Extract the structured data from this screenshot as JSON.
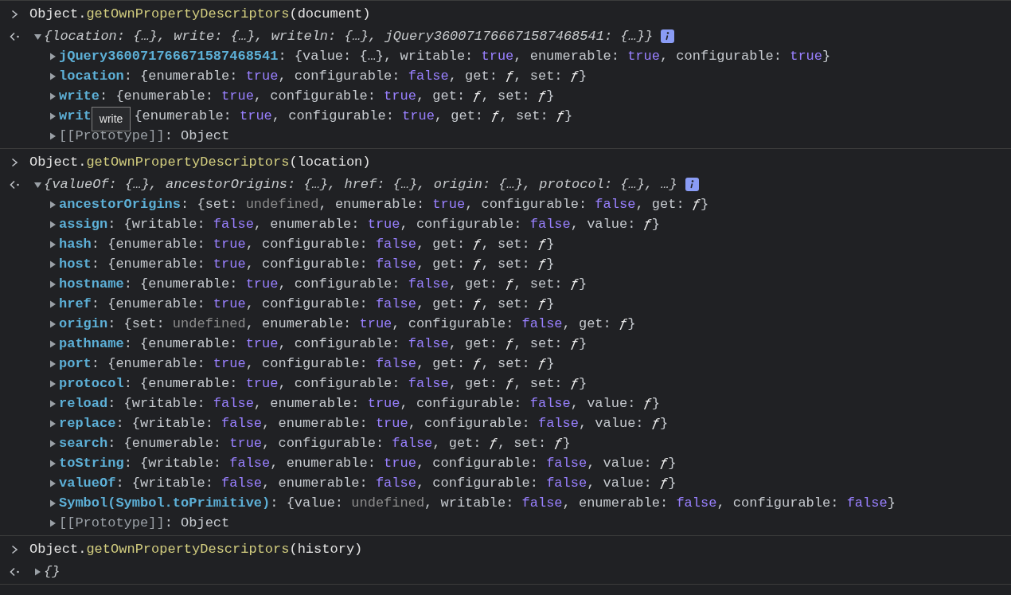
{
  "entries": [
    {
      "command": [
        {
          "text": "Object."
        },
        {
          "text": "getOwnPropertyDescriptors",
          "kind": "method"
        },
        {
          "text": "(document)"
        }
      ],
      "result": {
        "expanded": true,
        "summary": "{location: {…}, write: {…}, writeln: {…}, jQuery360071766671587468541: {…}}",
        "properties": [
          {
            "key": "jQuery360071766671587468541",
            "expanded": false,
            "value": [
              {
                "text": ": {value: {…}, writable: "
              },
              {
                "text": "true",
                "kind": "boolean"
              },
              {
                "text": ", enumerable: "
              },
              {
                "text": "true",
                "kind": "boolean"
              },
              {
                "text": ", configurable: "
              },
              {
                "text": "true",
                "kind": "boolean"
              },
              {
                "text": "}"
              }
            ]
          },
          {
            "key": "location",
            "expanded": false,
            "value": [
              {
                "text": ": {enumerable: "
              },
              {
                "text": "true",
                "kind": "boolean"
              },
              {
                "text": ", configurable: "
              },
              {
                "text": "false",
                "kind": "boolean"
              },
              {
                "text": ", get: "
              },
              {
                "text": "ƒ",
                "kind": "function"
              },
              {
                "text": ", set: "
              },
              {
                "text": "ƒ",
                "kind": "function"
              },
              {
                "text": "}"
              }
            ]
          },
          {
            "key": "write",
            "expanded": false,
            "value": [
              {
                "text": ": {enumerable: "
              },
              {
                "text": "true",
                "kind": "boolean"
              },
              {
                "text": ", configurable: "
              },
              {
                "text": "true",
                "kind": "boolean"
              },
              {
                "text": ", get: "
              },
              {
                "text": "ƒ",
                "kind": "function"
              },
              {
                "text": ", set: "
              },
              {
                "text": "ƒ",
                "kind": "function"
              },
              {
                "text": "}"
              }
            ]
          },
          {
            "key": "writ",
            "expanded": false,
            "tooltip": "write",
            "value": [
              {
                "text": "{enumerable: "
              },
              {
                "text": "true",
                "kind": "boolean"
              },
              {
                "text": ", configurable: "
              },
              {
                "text": "true",
                "kind": "boolean"
              },
              {
                "text": ", get: "
              },
              {
                "text": "ƒ",
                "kind": "function"
              },
              {
                "text": ", set: "
              },
              {
                "text": "ƒ",
                "kind": "function"
              },
              {
                "text": "}"
              }
            ]
          },
          {
            "key": "[[Prototype]]",
            "kind": "internal",
            "expanded": false,
            "value": [
              {
                "text": ": Object"
              }
            ]
          }
        ]
      }
    },
    {
      "command": [
        {
          "text": "Object."
        },
        {
          "text": "getOwnPropertyDescriptors",
          "kind": "method"
        },
        {
          "text": "(location)"
        }
      ],
      "result": {
        "expanded": true,
        "summary": "{valueOf: {…}, ancestorOrigins: {…}, href: {…}, origin: {…}, protocol: {…}, …}",
        "properties": [
          {
            "key": "ancestorOrigins",
            "expanded": false,
            "value": [
              {
                "text": ": {set: "
              },
              {
                "text": "undefined",
                "kind": "undefined"
              },
              {
                "text": ", enumerable: "
              },
              {
                "text": "true",
                "kind": "boolean"
              },
              {
                "text": ", configurable: "
              },
              {
                "text": "false",
                "kind": "boolean"
              },
              {
                "text": ", get: "
              },
              {
                "text": "ƒ",
                "kind": "function"
              },
              {
                "text": "}"
              }
            ]
          },
          {
            "key": "assign",
            "expanded": false,
            "value": [
              {
                "text": ": {writable: "
              },
              {
                "text": "false",
                "kind": "boolean"
              },
              {
                "text": ", enumerable: "
              },
              {
                "text": "true",
                "kind": "boolean"
              },
              {
                "text": ", configurable: "
              },
              {
                "text": "false",
                "kind": "boolean"
              },
              {
                "text": ", value: "
              },
              {
                "text": "ƒ",
                "kind": "function"
              },
              {
                "text": "}"
              }
            ]
          },
          {
            "key": "hash",
            "expanded": false,
            "value": [
              {
                "text": ": {enumerable: "
              },
              {
                "text": "true",
                "kind": "boolean"
              },
              {
                "text": ", configurable: "
              },
              {
                "text": "false",
                "kind": "boolean"
              },
              {
                "text": ", get: "
              },
              {
                "text": "ƒ",
                "kind": "function"
              },
              {
                "text": ", set: "
              },
              {
                "text": "ƒ",
                "kind": "function"
              },
              {
                "text": "}"
              }
            ]
          },
          {
            "key": "host",
            "expanded": false,
            "value": [
              {
                "text": ": {enumerable: "
              },
              {
                "text": "true",
                "kind": "boolean"
              },
              {
                "text": ", configurable: "
              },
              {
                "text": "false",
                "kind": "boolean"
              },
              {
                "text": ", get: "
              },
              {
                "text": "ƒ",
                "kind": "function"
              },
              {
                "text": ", set: "
              },
              {
                "text": "ƒ",
                "kind": "function"
              },
              {
                "text": "}"
              }
            ]
          },
          {
            "key": "hostname",
            "expanded": false,
            "value": [
              {
                "text": ": {enumerable: "
              },
              {
                "text": "true",
                "kind": "boolean"
              },
              {
                "text": ", configurable: "
              },
              {
                "text": "false",
                "kind": "boolean"
              },
              {
                "text": ", get: "
              },
              {
                "text": "ƒ",
                "kind": "function"
              },
              {
                "text": ", set: "
              },
              {
                "text": "ƒ",
                "kind": "function"
              },
              {
                "text": "}"
              }
            ]
          },
          {
            "key": "href",
            "expanded": false,
            "value": [
              {
                "text": ": {enumerable: "
              },
              {
                "text": "true",
                "kind": "boolean"
              },
              {
                "text": ", configurable: "
              },
              {
                "text": "false",
                "kind": "boolean"
              },
              {
                "text": ", get: "
              },
              {
                "text": "ƒ",
                "kind": "function"
              },
              {
                "text": ", set: "
              },
              {
                "text": "ƒ",
                "kind": "function"
              },
              {
                "text": "}"
              }
            ]
          },
          {
            "key": "origin",
            "expanded": false,
            "value": [
              {
                "text": ": {set: "
              },
              {
                "text": "undefined",
                "kind": "undefined"
              },
              {
                "text": ", enumerable: "
              },
              {
                "text": "true",
                "kind": "boolean"
              },
              {
                "text": ", configurable: "
              },
              {
                "text": "false",
                "kind": "boolean"
              },
              {
                "text": ", get: "
              },
              {
                "text": "ƒ",
                "kind": "function"
              },
              {
                "text": "}"
              }
            ]
          },
          {
            "key": "pathname",
            "expanded": false,
            "value": [
              {
                "text": ": {enumerable: "
              },
              {
                "text": "true",
                "kind": "boolean"
              },
              {
                "text": ", configurable: "
              },
              {
                "text": "false",
                "kind": "boolean"
              },
              {
                "text": ", get: "
              },
              {
                "text": "ƒ",
                "kind": "function"
              },
              {
                "text": ", set: "
              },
              {
                "text": "ƒ",
                "kind": "function"
              },
              {
                "text": "}"
              }
            ]
          },
          {
            "key": "port",
            "expanded": false,
            "value": [
              {
                "text": ": {enumerable: "
              },
              {
                "text": "true",
                "kind": "boolean"
              },
              {
                "text": ", configurable: "
              },
              {
                "text": "false",
                "kind": "boolean"
              },
              {
                "text": ", get: "
              },
              {
                "text": "ƒ",
                "kind": "function"
              },
              {
                "text": ", set: "
              },
              {
                "text": "ƒ",
                "kind": "function"
              },
              {
                "text": "}"
              }
            ]
          },
          {
            "key": "protocol",
            "expanded": false,
            "value": [
              {
                "text": ": {enumerable: "
              },
              {
                "text": "true",
                "kind": "boolean"
              },
              {
                "text": ", configurable: "
              },
              {
                "text": "false",
                "kind": "boolean"
              },
              {
                "text": ", get: "
              },
              {
                "text": "ƒ",
                "kind": "function"
              },
              {
                "text": ", set: "
              },
              {
                "text": "ƒ",
                "kind": "function"
              },
              {
                "text": "}"
              }
            ]
          },
          {
            "key": "reload",
            "expanded": false,
            "value": [
              {
                "text": ": {writable: "
              },
              {
                "text": "false",
                "kind": "boolean"
              },
              {
                "text": ", enumerable: "
              },
              {
                "text": "true",
                "kind": "boolean"
              },
              {
                "text": ", configurable: "
              },
              {
                "text": "false",
                "kind": "boolean"
              },
              {
                "text": ", value: "
              },
              {
                "text": "ƒ",
                "kind": "function"
              },
              {
                "text": "}"
              }
            ]
          },
          {
            "key": "replace",
            "expanded": false,
            "value": [
              {
                "text": ": {writable: "
              },
              {
                "text": "false",
                "kind": "boolean"
              },
              {
                "text": ", enumerable: "
              },
              {
                "text": "true",
                "kind": "boolean"
              },
              {
                "text": ", configurable: "
              },
              {
                "text": "false",
                "kind": "boolean"
              },
              {
                "text": ", value: "
              },
              {
                "text": "ƒ",
                "kind": "function"
              },
              {
                "text": "}"
              }
            ]
          },
          {
            "key": "search",
            "expanded": false,
            "value": [
              {
                "text": ": {enumerable: "
              },
              {
                "text": "true",
                "kind": "boolean"
              },
              {
                "text": ", configurable: "
              },
              {
                "text": "false",
                "kind": "boolean"
              },
              {
                "text": ", get: "
              },
              {
                "text": "ƒ",
                "kind": "function"
              },
              {
                "text": ", set: "
              },
              {
                "text": "ƒ",
                "kind": "function"
              },
              {
                "text": "}"
              }
            ]
          },
          {
            "key": "toString",
            "expanded": false,
            "value": [
              {
                "text": ": {writable: "
              },
              {
                "text": "false",
                "kind": "boolean"
              },
              {
                "text": ", enumerable: "
              },
              {
                "text": "true",
                "kind": "boolean"
              },
              {
                "text": ", configurable: "
              },
              {
                "text": "false",
                "kind": "boolean"
              },
              {
                "text": ", value: "
              },
              {
                "text": "ƒ",
                "kind": "function"
              },
              {
                "text": "}"
              }
            ]
          },
          {
            "key": "valueOf",
            "expanded": false,
            "value": [
              {
                "text": ": {writable: "
              },
              {
                "text": "false",
                "kind": "boolean"
              },
              {
                "text": ", enumerable: "
              },
              {
                "text": "false",
                "kind": "boolean"
              },
              {
                "text": ", configurable: "
              },
              {
                "text": "false",
                "kind": "boolean"
              },
              {
                "text": ", value: "
              },
              {
                "text": "ƒ",
                "kind": "function"
              },
              {
                "text": "}"
              }
            ]
          },
          {
            "key": "Symbol(Symbol.toPrimitive)",
            "expanded": false,
            "value": [
              {
                "text": ": {value: "
              },
              {
                "text": "undefined",
                "kind": "undefined"
              },
              {
                "text": ", writable: "
              },
              {
                "text": "false",
                "kind": "boolean"
              },
              {
                "text": ", enumerable: "
              },
              {
                "text": "false",
                "kind": "boolean"
              },
              {
                "text": ", configurable: "
              },
              {
                "text": "false",
                "kind": "boolean"
              },
              {
                "text": "}"
              }
            ]
          },
          {
            "key": "[[Prototype]]",
            "kind": "internal",
            "expanded": false,
            "value": [
              {
                "text": ": Object"
              }
            ]
          }
        ]
      }
    },
    {
      "command": [
        {
          "text": "Object."
        },
        {
          "text": "getOwnPropertyDescriptors",
          "kind": "method"
        },
        {
          "text": "(history)"
        }
      ],
      "result": {
        "expanded": false,
        "summary": "{}"
      }
    }
  ]
}
